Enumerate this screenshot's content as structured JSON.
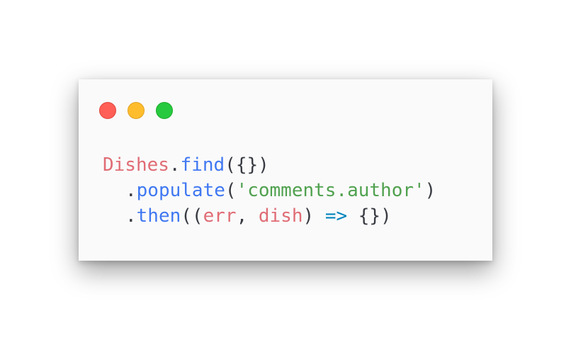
{
  "window": {
    "controls": [
      "close",
      "minimize",
      "maximize"
    ],
    "colors": {
      "background": "#fafafa",
      "close": "#ff5f56",
      "minimize": "#ffbd2e",
      "maximize": "#27c93f"
    }
  },
  "code": {
    "lines": [
      {
        "tokens": [
          {
            "text": "Dishes",
            "kind": "ident"
          },
          {
            "text": ".",
            "kind": "punct"
          },
          {
            "text": "find",
            "kind": "fn"
          },
          {
            "text": "({})",
            "kind": "punct"
          }
        ]
      },
      {
        "tokens": [
          {
            "text": ".",
            "kind": "punct"
          },
          {
            "text": "populate",
            "kind": "fn"
          },
          {
            "text": "(",
            "kind": "punct"
          },
          {
            "text": "'comments.author'",
            "kind": "str"
          },
          {
            "text": ")",
            "kind": "punct"
          }
        ]
      },
      {
        "tokens": [
          {
            "text": ".",
            "kind": "punct"
          },
          {
            "text": "then",
            "kind": "fn"
          },
          {
            "text": "((",
            "kind": "punct"
          },
          {
            "text": "err",
            "kind": "ident"
          },
          {
            "text": ", ",
            "kind": "punct"
          },
          {
            "text": "dish",
            "kind": "ident"
          },
          {
            "text": ") ",
            "kind": "punct"
          },
          {
            "text": "=>",
            "kind": "op"
          },
          {
            "text": " {})",
            "kind": "punct"
          }
        ]
      }
    ],
    "colors": {
      "ident": "#e06c75",
      "fn": "#4078f2",
      "str": "#50a14f",
      "op": "#0184bc",
      "punct": "#383a42"
    }
  }
}
